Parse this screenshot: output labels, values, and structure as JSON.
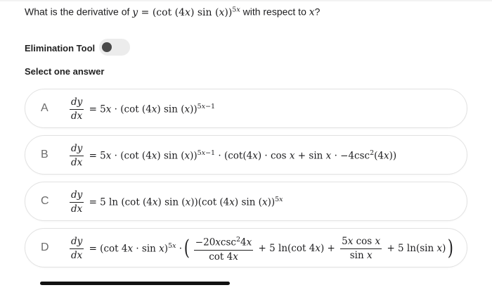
{
  "question": {
    "prefix": "What is the derivative of ",
    "suffix": " with respect to ",
    "var": "x",
    "end": "?"
  },
  "elimination": {
    "label": "Elimination Tool",
    "toggle_state": "off"
  },
  "select_label": "Select one answer",
  "options": [
    {
      "letter": "A"
    },
    {
      "letter": "B"
    },
    {
      "letter": "C"
    },
    {
      "letter": "D"
    }
  ],
  "colors": {
    "border": "#e2e2e2",
    "text": "#1d1d1f",
    "knob": "#4a4a4a"
  }
}
